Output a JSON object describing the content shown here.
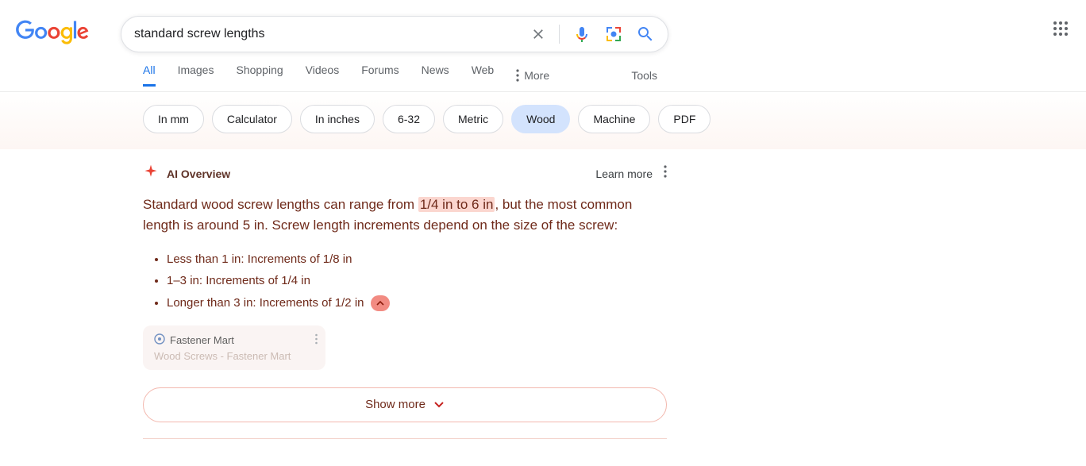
{
  "search": {
    "query": "standard screw lengths"
  },
  "tabs": {
    "all": "All",
    "images": "Images",
    "shopping": "Shopping",
    "videos": "Videos",
    "forums": "Forums",
    "news": "News",
    "web": "Web",
    "more": "More",
    "tools": "Tools"
  },
  "chips": [
    "In mm",
    "Calculator",
    "In inches",
    "6-32",
    "Metric",
    "Wood",
    "Machine",
    "PDF"
  ],
  "ai": {
    "title": "AI Overview",
    "learn_more": "Learn more",
    "summary_pre": "Standard wood screw lengths can range from ",
    "summary_hl": "1/4 in to 6 in",
    "summary_post": ", but the most common length is around 5 in. Screw length increments depend on the size of the screw:",
    "bullets": [
      "Less than 1 in: Increments of 1/8 in",
      "1–3 in: Increments of 1/4 in",
      "Longer than 3 in: Increments of 1/2 in"
    ],
    "source": {
      "site": "Fastener Mart",
      "title": "Wood Screws - Fastener Mart"
    },
    "show_more": "Show more"
  }
}
